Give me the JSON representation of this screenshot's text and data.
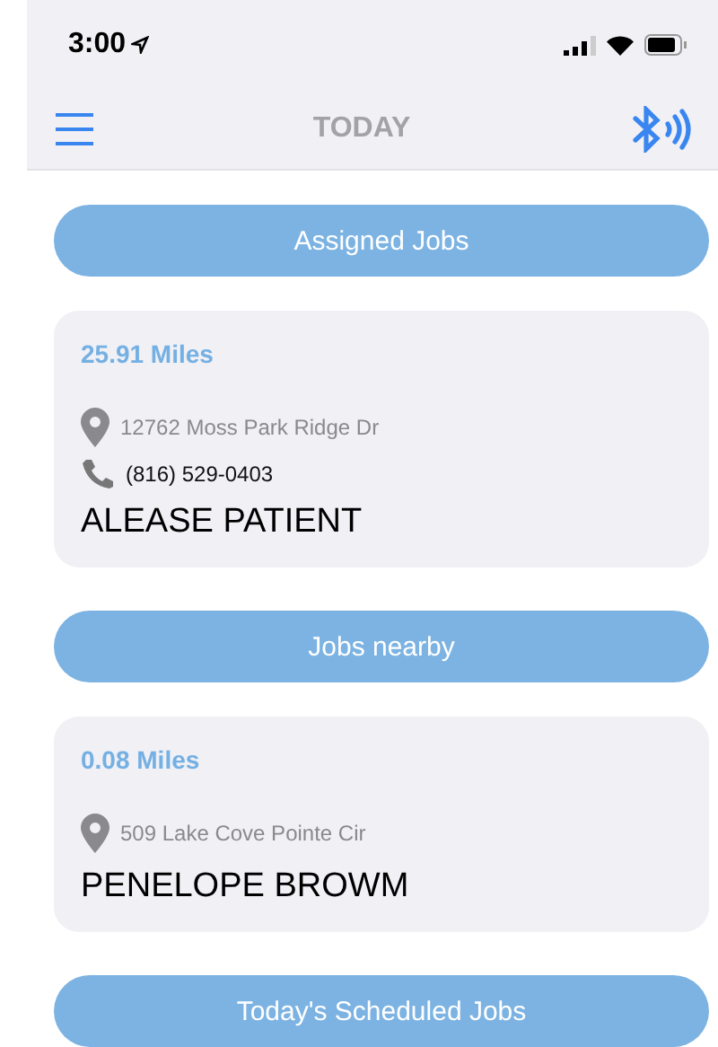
{
  "status_bar": {
    "time": "3:00"
  },
  "nav": {
    "title": "TODAY"
  },
  "sections": [
    {
      "title": "Assigned Jobs",
      "jobs": [
        {
          "distance": "25.91 Miles",
          "address": "12762 Moss Park Ridge Dr",
          "phone": "(816) 529-0403",
          "name": "ALEASE PATIENT"
        }
      ]
    },
    {
      "title": "Jobs nearby",
      "jobs": [
        {
          "distance": "0.08 Miles",
          "address": "509 Lake Cove Pointe Cir",
          "name": "PENELOPE BROWM"
        }
      ]
    },
    {
      "title": "Today's Scheduled Jobs"
    }
  ]
}
